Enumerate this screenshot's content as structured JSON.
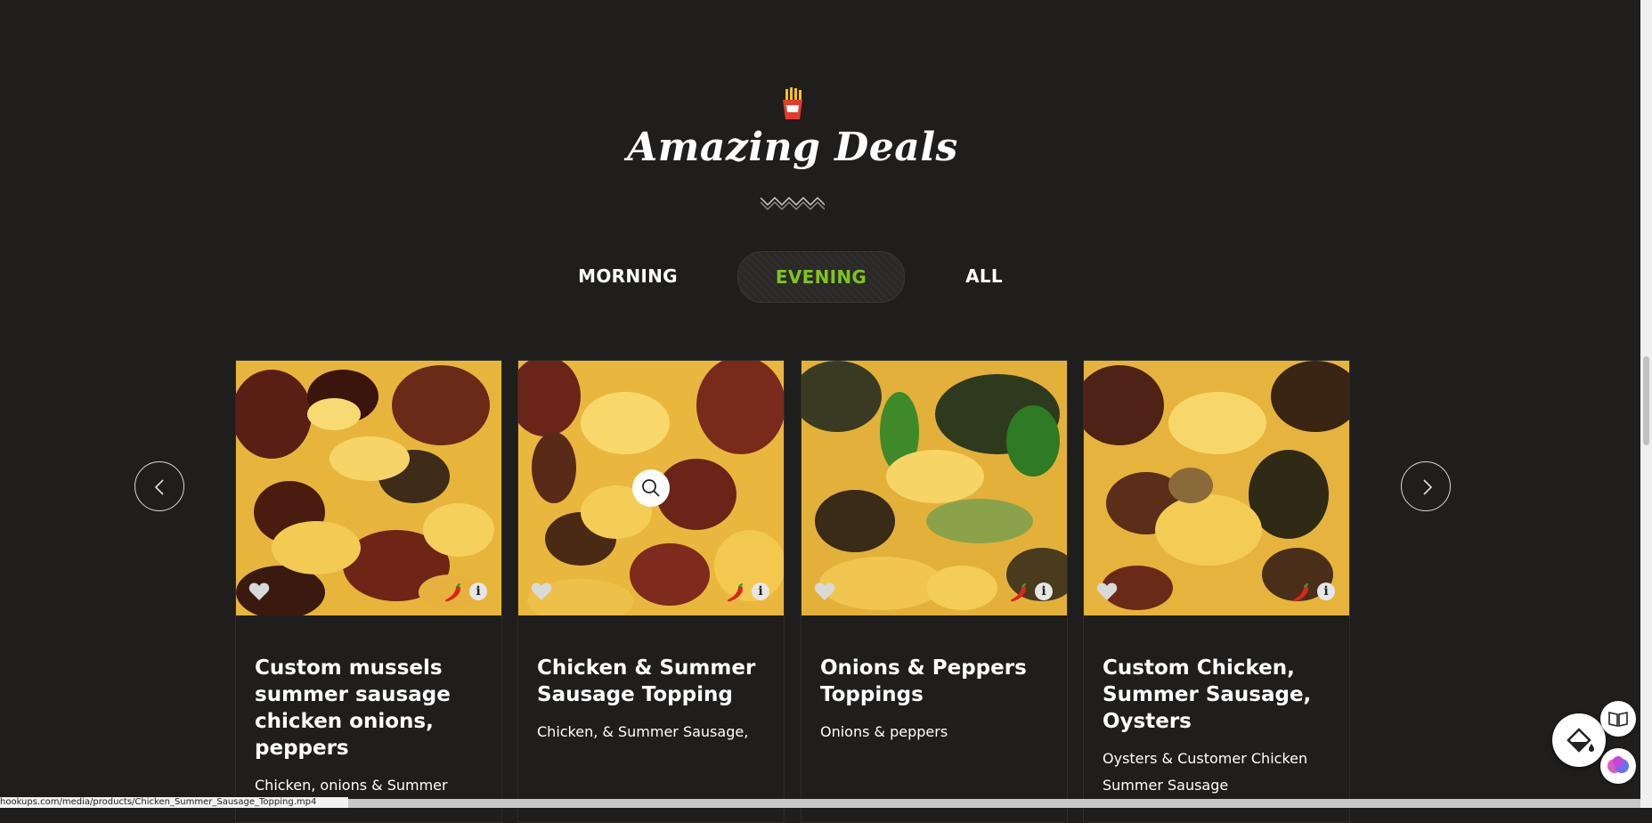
{
  "section": {
    "icon": "fries-icon",
    "title": "Amazing Deals"
  },
  "tabs": [
    {
      "label": "MORNING",
      "active": false
    },
    {
      "label": "EVENING",
      "active": true
    },
    {
      "label": "ALL",
      "active": false
    }
  ],
  "colors": {
    "background": "#1f1e1d",
    "accent": "#7fc41c",
    "cheese": "#f2c94c",
    "text": "#ffffff"
  },
  "cards": [
    {
      "title": "Custom mussels summer sausage chicken onions, peppers",
      "description": "Chicken, onions & Summer"
    },
    {
      "title": "Chicken & Summer Sausage Topping",
      "description": "Chicken, & Summer Sausage,"
    },
    {
      "title": "Onions & Peppers Toppings",
      "description": "Onions & peppers"
    },
    {
      "title": "Custom Chicken, Summer Sausage, Oysters",
      "description": "Oysters & Customer Chicken Summer Sausage"
    }
  ],
  "status_bar": {
    "url": "hookups.com/media/products/Chicken_Summer_Sausage_Topping.mp4"
  }
}
